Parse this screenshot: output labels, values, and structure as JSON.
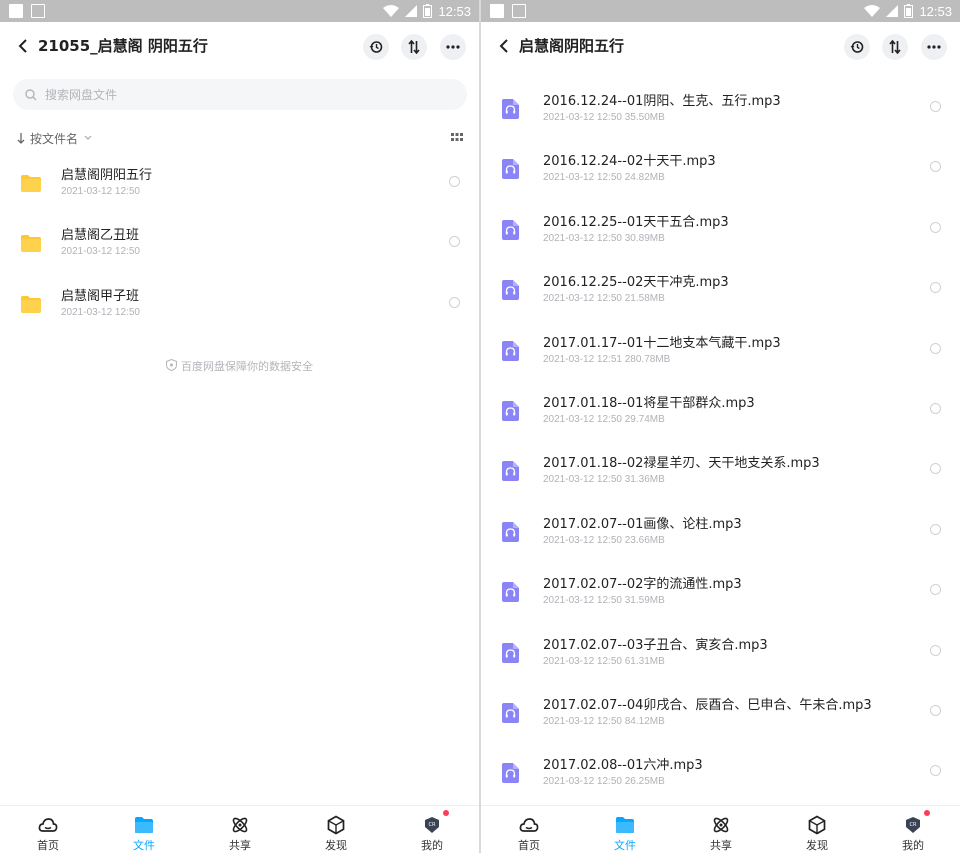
{
  "status": {
    "time": "12:53"
  },
  "left": {
    "title": "21055_启慧阁  阴阳五行",
    "search_placeholder": "搜索网盘文件",
    "sort_label": "按文件名",
    "folders": [
      {
        "name": "启慧阁阴阳五行",
        "meta": "2021-03-12  12:50"
      },
      {
        "name": "启慧阁乙丑班",
        "meta": "2021-03-12  12:50"
      },
      {
        "name": "启慧阁甲子班",
        "meta": "2021-03-12  12:50"
      }
    ],
    "safety_note": "百度网盘保障你的数据安全"
  },
  "right": {
    "title": "启慧阁阴阳五行",
    "files": [
      {
        "name": "2016.12.24--01阴阳、生克、五行.mp3",
        "meta": "2021-03-12  12:50  35.50MB"
      },
      {
        "name": "2016.12.24--02十天干.mp3",
        "meta": "2021-03-12  12:50  24.82MB"
      },
      {
        "name": "2016.12.25--01天干五合.mp3",
        "meta": "2021-03-12  12:50  30.89MB"
      },
      {
        "name": "2016.12.25--02天干冲克.mp3",
        "meta": "2021-03-12  12:50  21.58MB"
      },
      {
        "name": "2017.01.17--01十二地支本气藏干.mp3",
        "meta": "2021-03-12  12:51  280.78MB"
      },
      {
        "name": "2017.01.18--01将星干部群众.mp3",
        "meta": "2021-03-12  12:50  29.74MB"
      },
      {
        "name": "2017.01.18--02禄星羊刃、天干地支关系.mp3",
        "meta": "2021-03-12  12:50  31.36MB"
      },
      {
        "name": "2017.02.07--01画像、论柱.mp3",
        "meta": "2021-03-12  12:50  23.66MB"
      },
      {
        "name": "2017.02.07--02字的流通性.mp3",
        "meta": "2021-03-12  12:50  31.59MB"
      },
      {
        "name": "2017.02.07--03子丑合、寅亥合.mp3",
        "meta": "2021-03-12  12:50  61.31MB"
      },
      {
        "name": "2017.02.07--04卯戌合、辰酉合、巳申合、午未合.mp3",
        "meta": "2021-03-12  12:50  84.12MB"
      },
      {
        "name": "2017.02.08--01六冲.mp3",
        "meta": "2021-03-12  12:50  26.25MB"
      }
    ]
  },
  "tabs": [
    {
      "label": "首页",
      "icon": "cloud-icon"
    },
    {
      "label": "文件",
      "icon": "folder-icon"
    },
    {
      "label": "共享",
      "icon": "share-icon"
    },
    {
      "label": "发现",
      "icon": "discover-icon"
    },
    {
      "label": "我的",
      "icon": "profile-icon"
    }
  ],
  "colors": {
    "accent": "#06a7ff",
    "folder": "#ffc733",
    "audio": "#8b84f6",
    "badge": "#ff3b5c"
  }
}
